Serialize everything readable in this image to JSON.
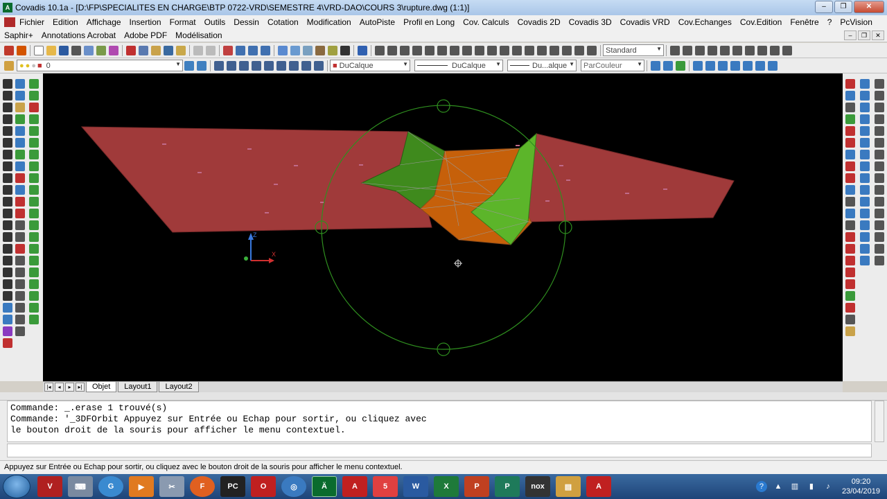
{
  "window": {
    "app_icon": "covadis-app-icon",
    "title": "Covadis 10.1a - [D:\\FP\\SPECIALITES EN CHARGE\\BTP 0722-VRD\\SEMESTRE 4\\VRD-DAO\\COURS 3\\rupture.dwg (1:1)]",
    "minimize": "–",
    "restore": "❐",
    "close": "✕"
  },
  "menubar": {
    "items": [
      "Fichier",
      "Edition",
      "Affichage",
      "Insertion",
      "Format",
      "Outils",
      "Dessin",
      "Cotation",
      "Modification",
      "AutoPiste",
      "Profil en Long",
      "Cov. Calculs",
      "Covadis 2D",
      "Covadis 3D",
      "Covadis VRD",
      "Cov.Echanges",
      "Cov.Edition",
      "Fenêtre",
      "?",
      "PcVision"
    ]
  },
  "menubar2": {
    "items": [
      "Saphir+",
      "Annotations Acrobat",
      "Adobe PDF",
      "Modélisation"
    ],
    "mdi_minimize": "–",
    "mdi_restore": "❐",
    "mdi_close": "✕"
  },
  "toolbar1": {
    "text_style": "Standard"
  },
  "toolbar2": {
    "layer": "0",
    "color": "DuCalque",
    "linetype": "DuCalque",
    "lineweight": "Du...alque",
    "plotstyle": "ParCouleur"
  },
  "viewport": {
    "ucs_z": "Z",
    "ucs_x": "X",
    "surface_color": "#a03a3a",
    "slope_colors": [
      "#3f8a1d",
      "#5cb52a",
      "#c6600a"
    ],
    "orbit_circle_color": "#2f8f1f"
  },
  "layout_tabs": {
    "nav": [
      "|◂",
      "◂",
      "▸",
      "▸|"
    ],
    "tabs": [
      "Objet",
      "Layout1",
      "Layout2"
    ],
    "active": "Objet"
  },
  "command": {
    "line1": "Commande:  _.erase 1 trouvé(s)",
    "line2": "Commande: '_3DFOrbit Appuyez sur Entrée ou Echap pour sortir, ou cliquez avec",
    "line3": "le bouton droit de la souris pour afficher le menu contextuel."
  },
  "status": {
    "text": "Appuyez sur Entrée ou Echap pour sortir, ou cliquez avec le bouton droit de la souris pour afficher le menu contextuel."
  },
  "taskbar": {
    "apps": [
      "pdf-reader",
      "keyboard-app",
      "chrome",
      "media-player",
      "snipping-tool",
      "firefox",
      "pycharm",
      "oracle",
      "globe-app",
      "covadis",
      "acrobat-pro",
      "tool-5",
      "word",
      "excel",
      "powerpoint",
      "publisher",
      "nox",
      "file-explorer",
      "acrobat"
    ],
    "app_labels": [
      "V",
      "⌨",
      "G",
      "▶",
      "✂",
      "F",
      "PC",
      "O",
      "◎",
      "Ä",
      "A",
      "5",
      "W",
      "X",
      "P",
      "P",
      "nox",
      "▤",
      "A"
    ],
    "time": "09:20",
    "date": "23/04/2019"
  }
}
